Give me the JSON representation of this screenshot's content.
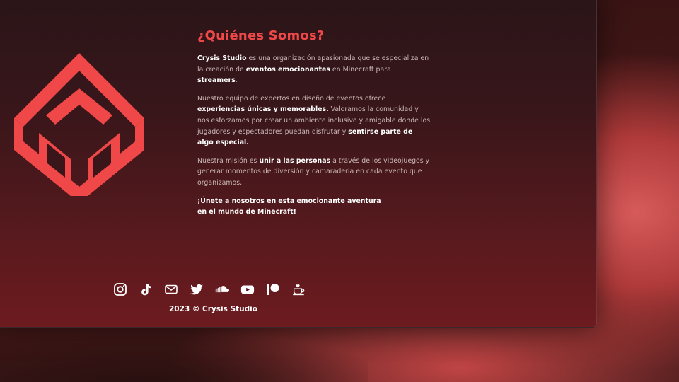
{
  "about": {
    "title": "¿Quiénes Somos?",
    "p1": [
      {
        "t": "Crysis Studio",
        "b": true
      },
      {
        "t": " es una organización apasionada que se especializa en la creación de ",
        "b": false
      },
      {
        "t": "eventos emocionantes",
        "b": true
      },
      {
        "t": " en Minecraft para ",
        "b": false
      },
      {
        "t": "streamers",
        "b": true
      },
      {
        "t": ".",
        "b": false
      }
    ],
    "p2": [
      {
        "t": "Nuestro equipo de expertos en diseño de eventos ofrece ",
        "b": false
      },
      {
        "t": "experiencias únicas y memorables.",
        "b": true
      },
      {
        "t": " Valoramos la comunidad y nos esforzamos por crear un ambiente inclusivo y amigable donde los jugadores y espectadores puedan disfrutar y ",
        "b": false
      },
      {
        "t": "sentirse parte de algo especial.",
        "b": true
      }
    ],
    "p3": [
      {
        "t": "Nuestra misión es ",
        "b": false
      },
      {
        "t": "unir a las personas",
        "b": true
      },
      {
        "t": " a través de los videojuegos y generar momentos de diversión y camaradería en cada evento que organizamos.",
        "b": false
      }
    ],
    "cta_line1": "¡Únete a nosotros en esta emocionante aventura",
    "cta_line2": "en el mundo de Minecraft!"
  },
  "footer": {
    "copyright": "2023 © Crysis Studio",
    "socials": [
      "instagram-icon",
      "tiktok-icon",
      "email-icon",
      "twitter-icon",
      "soundcloud-icon",
      "youtube-icon",
      "patreon-icon",
      "kofi-icon"
    ]
  },
  "colors": {
    "accent": "#f04848",
    "text": "#c9b5b5",
    "strong": "#ffffff"
  }
}
